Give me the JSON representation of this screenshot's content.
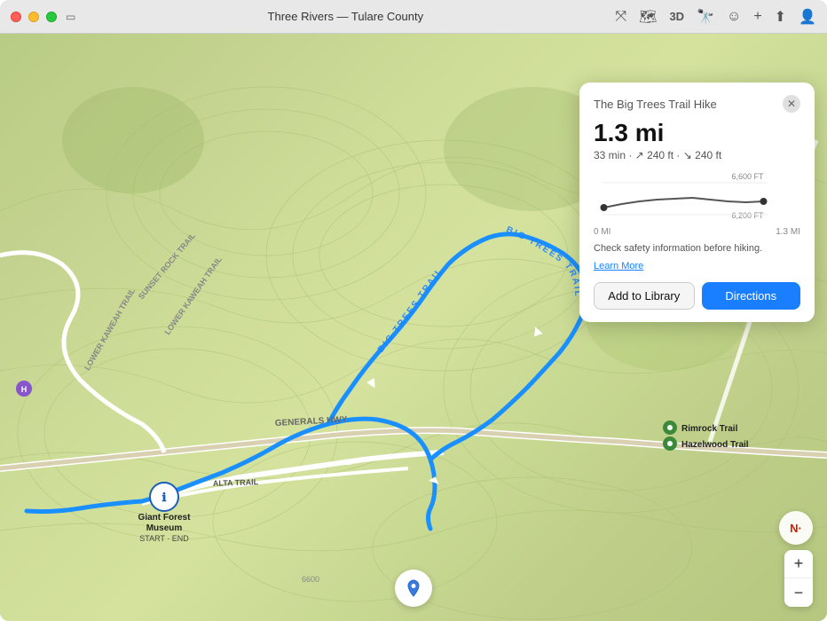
{
  "window": {
    "title": "Three Rivers — Tulare County"
  },
  "toolbar": {
    "buttons": [
      "directions-icon",
      "map-icon",
      "3d-label",
      "binoculars-icon",
      "smiley-icon",
      "add-icon",
      "share-icon",
      "account-icon"
    ]
  },
  "card": {
    "title": "The Big Trees Trail Hike",
    "distance": "1.3 mi",
    "meta": "33 min · ↗ 240 ft · ↘ 240 ft",
    "elevation_high": "6,600 FT",
    "elevation_low": "6,200 FT",
    "distance_start": "0 MI",
    "distance_end": "1.3 MI",
    "safety_text": "Check safety information before hiking.",
    "learn_more": "Learn More",
    "btn_library": "Add to Library",
    "btn_directions": "Directions"
  },
  "map": {
    "trails": [
      {
        "label": "BIG TREES TRAIL"
      },
      {
        "label": "ALTA TRAIL"
      },
      {
        "label": "GENERALS HWY"
      }
    ],
    "markers": [
      {
        "label": "Giant Forest Museum",
        "sublabel": "START · END"
      },
      {
        "label": "Rimrock Trail"
      },
      {
        "label": "Hazelwood Trail"
      }
    ]
  },
  "controls": {
    "zoom_in": "+",
    "zoom_out": "−",
    "compass": "N·"
  }
}
